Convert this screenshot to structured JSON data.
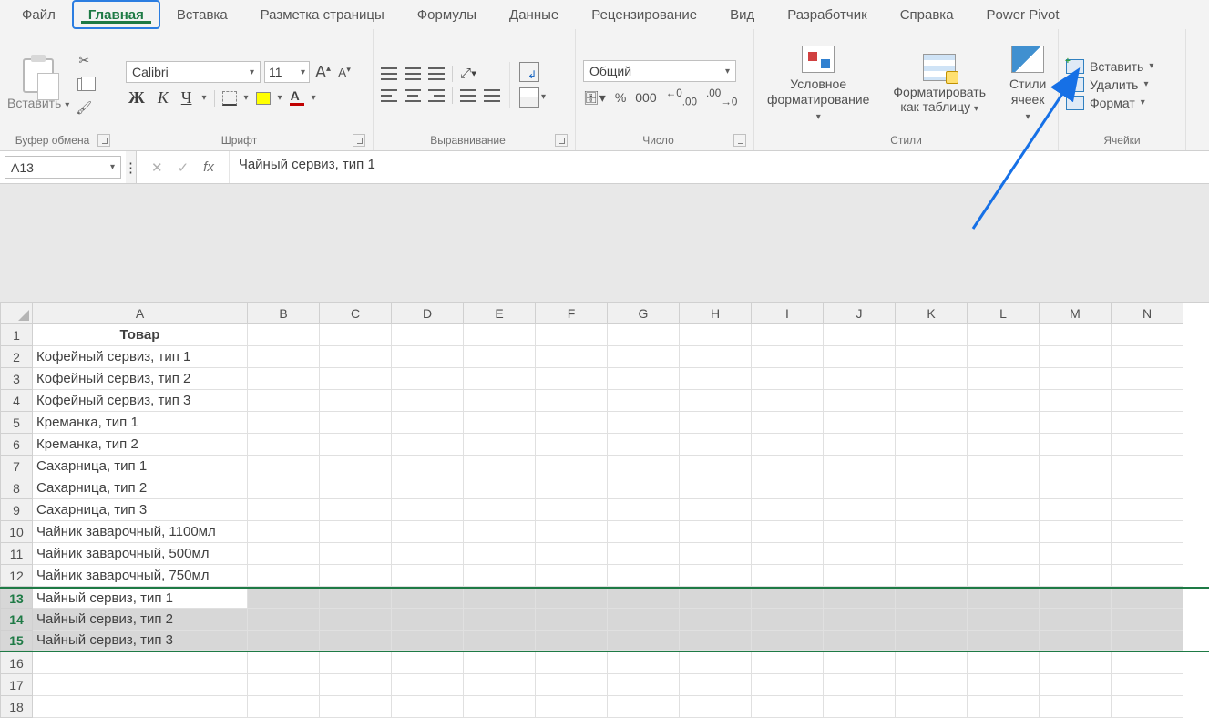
{
  "tabs": [
    "Файл",
    "Главная",
    "Вставка",
    "Разметка страницы",
    "Формулы",
    "Данные",
    "Рецензирование",
    "Вид",
    "Разработчик",
    "Справка",
    "Power Pivot"
  ],
  "active_tab": 1,
  "ribbon": {
    "clipboard": {
      "paste": "Вставить",
      "label": "Буфер обмена"
    },
    "font": {
      "name": "Calibri",
      "size": "11",
      "label": "Шрифт"
    },
    "alignment": {
      "label": "Выравнивание"
    },
    "number": {
      "format": "Общий",
      "label": "Число"
    },
    "styles": {
      "cond": "Условное\nформатирование",
      "table": "Форматировать\nкак таблицу",
      "cell": "Стили\nячеек",
      "label": "Стили"
    },
    "cells": {
      "insert": "Вставить",
      "delete": "Удалить",
      "format": "Формат",
      "label": "Ячейки"
    }
  },
  "name_box": "A13",
  "formula": "Чайный сервиз, тип 1",
  "columns": [
    "A",
    "B",
    "C",
    "D",
    "E",
    "F",
    "G",
    "H",
    "I",
    "J",
    "K",
    "L",
    "M",
    "N"
  ],
  "rows": [
    {
      "h": "1",
      "A": "Товар",
      "type": "header"
    },
    {
      "h": "2",
      "A": "Кофейный сервиз, тип 1"
    },
    {
      "h": "3",
      "A": "Кофейный сервиз, тип 2"
    },
    {
      "h": "4",
      "A": "Кофейный сервиз, тип 3"
    },
    {
      "h": "5",
      "A": "Креманка, тип 1"
    },
    {
      "h": "6",
      "A": "Креманка, тип 2"
    },
    {
      "h": "7",
      "A": "Сахарница, тип 1"
    },
    {
      "h": "8",
      "A": "Сахарница, тип 2"
    },
    {
      "h": "9",
      "A": "Сахарница, тип 3"
    },
    {
      "h": "10",
      "A": "Чайник заварочный, 1100мл"
    },
    {
      "h": "11",
      "A": "Чайник заварочный, 500мл"
    },
    {
      "h": "12",
      "A": "Чайник заварочный, 750мл"
    },
    {
      "h": "13",
      "A": "Чайный сервиз, тип 1",
      "sel": true,
      "active": true
    },
    {
      "h": "14",
      "A": "Чайный сервиз, тип 2",
      "sel": true
    },
    {
      "h": "15",
      "A": "Чайный сервиз, тип 3",
      "sel": true
    },
    {
      "h": "16",
      "A": ""
    },
    {
      "h": "17",
      "A": ""
    },
    {
      "h": "18",
      "A": ""
    }
  ]
}
